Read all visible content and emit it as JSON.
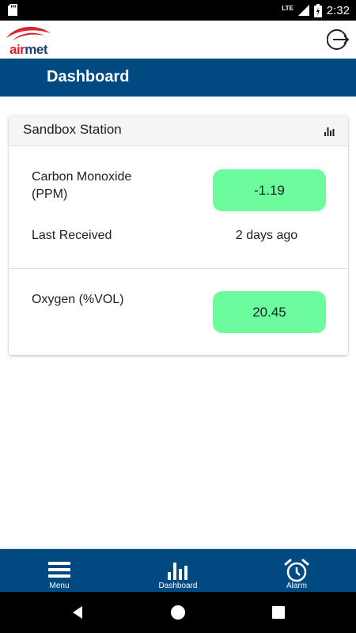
{
  "status_bar": {
    "time": "2:32",
    "network": "LTE"
  },
  "app": {
    "logo_text_air": "air",
    "logo_text_met": "met",
    "logout_icon": "logout-icon"
  },
  "title_bar": {
    "title": "Dashboard"
  },
  "station": {
    "name": "Sandbox Station",
    "chart_icon": "bar-chart-icon",
    "readings": [
      {
        "label_line1": "Carbon Monoxide",
        "label_line2": "(PPM)",
        "value": "-1.19",
        "received_label": "Last Received",
        "received_value": "2 days ago"
      },
      {
        "label_line1": "Oxygen (%VOL)",
        "value": "20.45"
      }
    ],
    "pill_color": "#6cfc9e"
  },
  "bottom_nav": {
    "items": [
      {
        "label": "Menu",
        "icon": "hamburger-menu-icon"
      },
      {
        "label": "Dashboard",
        "icon": "bar-chart-icon"
      },
      {
        "label": "Alarm",
        "icon": "alarm-clock-icon"
      }
    ]
  },
  "colors": {
    "primary": "#004a82",
    "logo_red": "#d7262e",
    "logo_blue": "#1c3d7a"
  }
}
